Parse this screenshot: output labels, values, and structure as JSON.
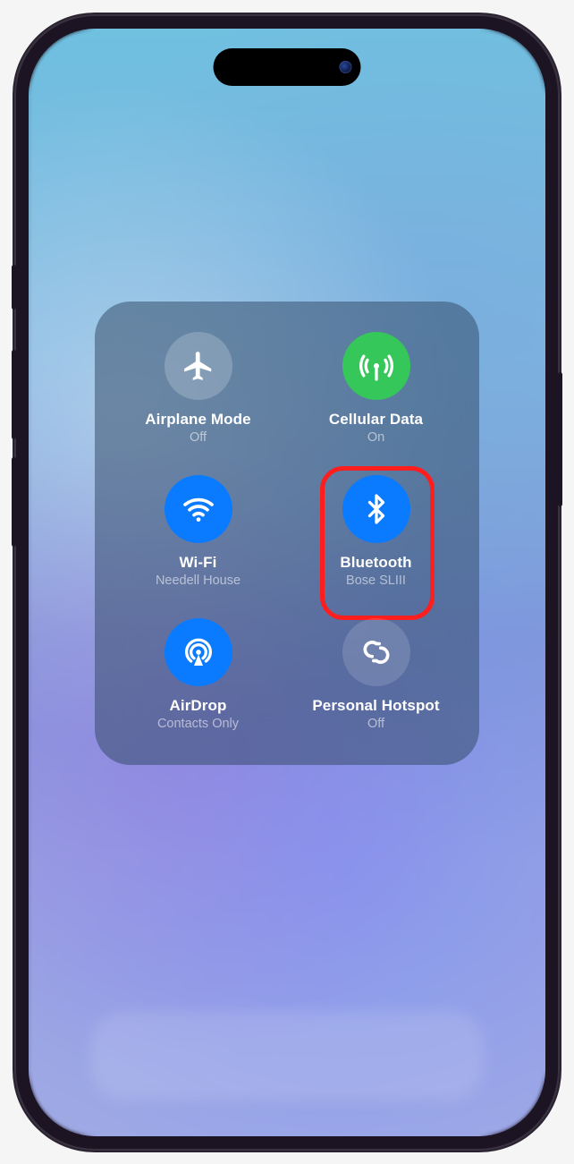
{
  "tiles": {
    "airplane": {
      "title": "Airplane Mode",
      "sub": "Off"
    },
    "cellular": {
      "title": "Cellular Data",
      "sub": "On"
    },
    "wifi": {
      "title": "Wi-Fi",
      "sub": "Needell House"
    },
    "bluetooth": {
      "title": "Bluetooth",
      "sub": "Bose SLIII"
    },
    "airdrop": {
      "title": "AirDrop",
      "sub": "Contacts Only"
    },
    "hotspot": {
      "title": "Personal Hotspot",
      "sub": "Off"
    }
  },
  "colors": {
    "accent_blue": "#0a7bff",
    "accent_green": "#35c759",
    "highlight_red": "#ff1e1e"
  }
}
